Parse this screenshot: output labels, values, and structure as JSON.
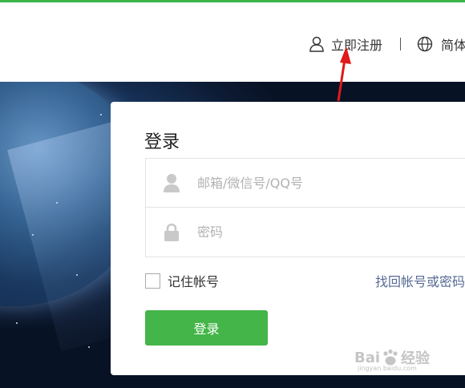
{
  "theme": {
    "accent": "#3cb64b",
    "button": "#44b549",
    "link": "#576b95",
    "arrow": "#e01a1a"
  },
  "header": {
    "register_label": "立即注册",
    "register_icon": "user-icon",
    "language_label": "简体",
    "language_icon": "globe-icon"
  },
  "login": {
    "title": "登录",
    "username_placeholder": "邮箱/微信号/QQ号",
    "username_icon": "user-icon",
    "password_placeholder": "密码",
    "password_icon": "lock-icon",
    "remember_label": "记住帐号",
    "forgot_label": "找回帐号或密码",
    "submit_label": "登录"
  },
  "watermark": {
    "brand": "Bai",
    "brand2": "经验",
    "url": "jingyan.baidu.com"
  }
}
